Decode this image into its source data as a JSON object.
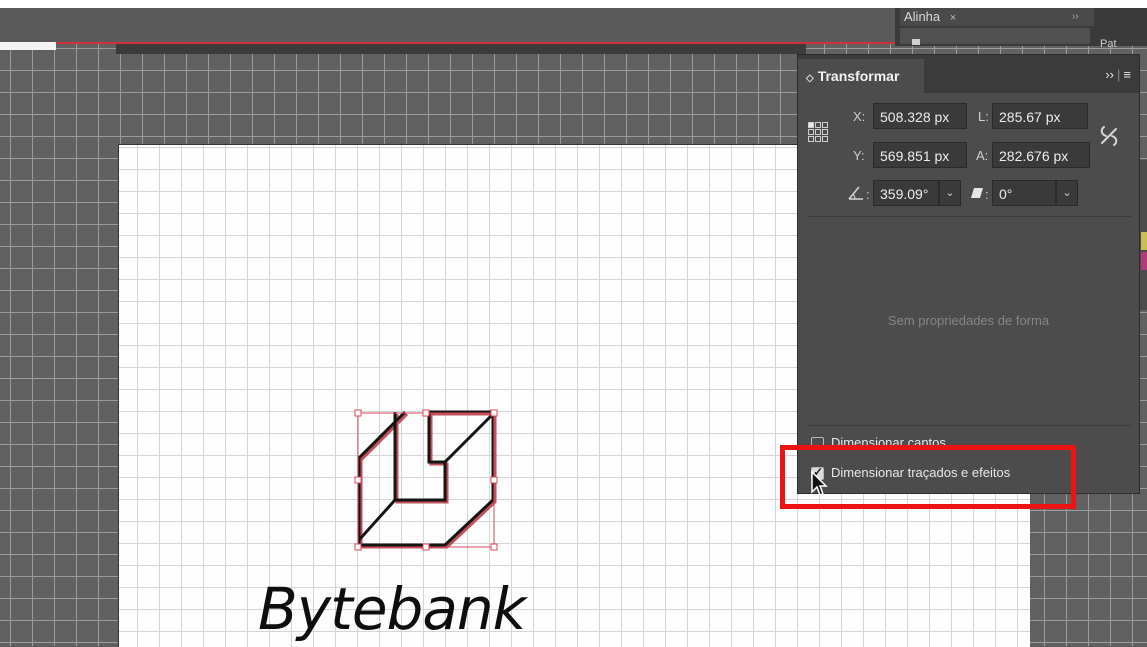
{
  "artwork": {
    "brand_name": "Bytebank"
  },
  "dock": {
    "tab_label": "Alinha",
    "tab_close": "×",
    "tab_overflow": "››",
    "right_label": "Pat"
  },
  "transform_panel": {
    "title": "Transformar",
    "collapse_icon": "◇",
    "overflow": "››",
    "menu": "≡",
    "fields": {
      "x_label": "X:",
      "x_value": "508.328 px",
      "w_label": "L:",
      "w_value": "285.67 px",
      "y_label": "Y:",
      "y_value": "569.851 px",
      "h_label": "A:",
      "h_value": "282.676 px",
      "rotate_value": "359.09°",
      "shear_value": "0°"
    },
    "no_shape_props": "Sem propriedades de forma",
    "options": [
      {
        "label": "Dimensionar cantos",
        "checked": false
      },
      {
        "label": "Dimensionar traçados e efeitos",
        "checked": true
      }
    ]
  },
  "colors": {
    "highlight": "#ee1313",
    "selection": "#d8485a",
    "panel_bg": "#4c4c4c"
  }
}
